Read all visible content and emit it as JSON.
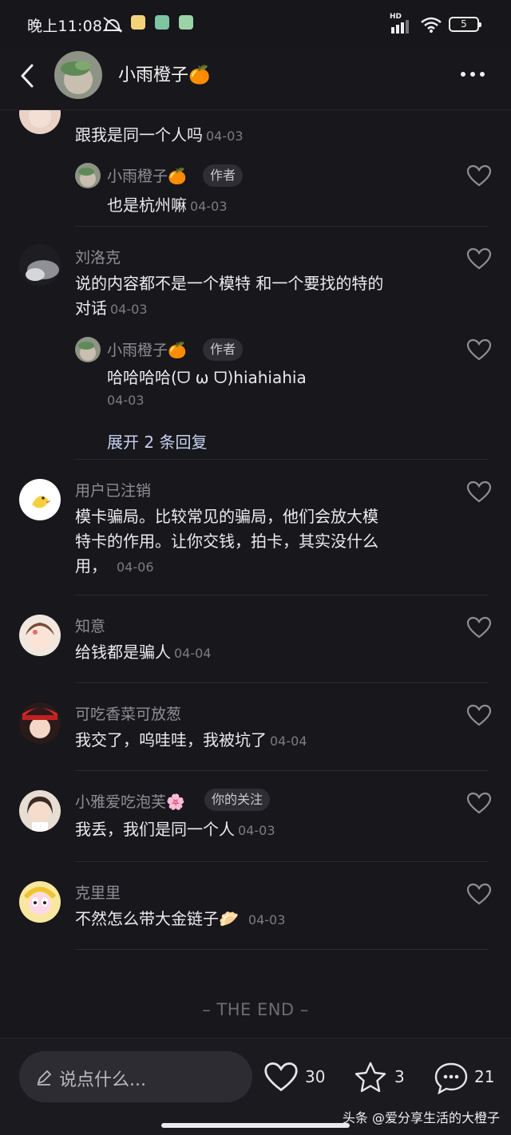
{
  "status_bar": {
    "time": "晚上11:08",
    "battery": "5",
    "network_label": "HD"
  },
  "header": {
    "title": "小雨橙子🍊"
  },
  "comments": [
    {
      "text": "跟我是同一个人吗",
      "date": "04-03"
    },
    {
      "username": "小雨橙子🍊",
      "badge": "作者",
      "text": "也是杭州嘛",
      "date": "04-03"
    },
    {
      "username": "刘洛克",
      "text_line1": "说的内容都不是一个模特 和一个要找的特的",
      "text_line2": "对话",
      "date": "04-03"
    },
    {
      "username": "小雨橙子🍊",
      "badge": "作者",
      "text": "哈哈哈哈(ᗜ ω ᗜ)hiahiahia",
      "date": "04-03",
      "expand": "展开 2 条回复"
    },
    {
      "username": "用户已注销",
      "text_line1": "模卡骗局。比较常见的骗局，他们会放大模",
      "text_line2": "特卡的作用。让你交钱，拍卡，其实没什么",
      "text_line3": "用，",
      "date": "04-06"
    },
    {
      "username": "知意",
      "text": "给钱都是骗人",
      "date": "04-04"
    },
    {
      "username": "可吃香菜可放葱",
      "text": "我交了，呜哇哇，我被坑了",
      "date": "04-04"
    },
    {
      "username": "小雅爱吃泡芙🌸",
      "badge": "你的关注",
      "text": "我丢，我们是同一个人",
      "date": "04-03"
    },
    {
      "username": "克里里",
      "text": "不然怎么带大金链子🥟",
      "date": "04-03"
    }
  ],
  "end_text": "– THE END –",
  "bottom_bar": {
    "input_placeholder": "说点什么...",
    "like_count": "30",
    "star_count": "3",
    "comment_count": "21",
    "watermark": "头条 @爱分享生活的大橙子"
  },
  "colors": {
    "background": "#17171c",
    "text": "#ececee",
    "muted": "#8e8e94",
    "link": "#c7d3f0"
  },
  "icons": [
    "back-arrow-icon",
    "more-icon",
    "heart-icon",
    "star-icon",
    "comment-bubble-icon",
    "pencil-icon",
    "wifi-icon",
    "signal-icon",
    "battery-icon"
  ]
}
